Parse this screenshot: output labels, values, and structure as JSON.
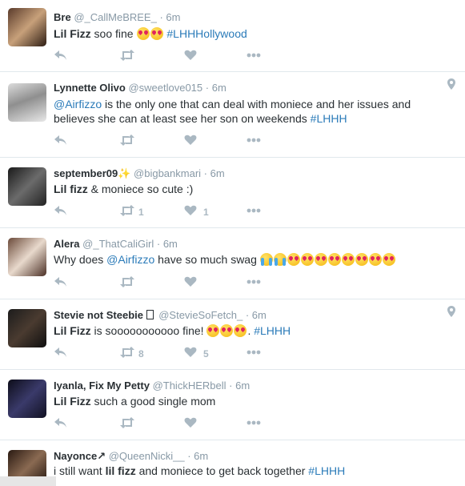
{
  "colors": {
    "link": "#2b7bb9",
    "muted": "#8899a6",
    "icon": "#aab8c2",
    "text": "#292f33",
    "border": "#e1e8ed"
  },
  "icons": {
    "reply": "reply-icon",
    "retweet": "retweet-icon",
    "like": "heart-icon",
    "more": "more-icon",
    "location": "location-pin-icon",
    "heart_eyes": "heart-eyes-emoji",
    "crying": "crying-emoji"
  },
  "tweets": [
    {
      "name": "Bre",
      "handle": "@_CallMeBREE_",
      "sep": "·",
      "time": "6m",
      "text": {
        "b1": "Lil Fizz",
        "t1": " soo fine ",
        "link1": "#LHHHollywood"
      },
      "retweets": "",
      "likes": ""
    },
    {
      "name": "Lynnette Olivo",
      "handle": "@sweetlove015",
      "sep": "·",
      "time": "6m",
      "text": {
        "link1": "@Airfizzo",
        "t1": " is the only one that can deal with moniece and her issues and believes she can at least see her son on weekends ",
        "link2": "#LHHH"
      },
      "retweets": "",
      "likes": ""
    },
    {
      "name": "september09✨",
      "handle": "@bigbankmari",
      "sep": "·",
      "time": "6m",
      "text": {
        "b1": "Lil fizz",
        "t1": " & moniece so cute :)"
      },
      "retweets": "1",
      "likes": "1"
    },
    {
      "name": "Alera",
      "handle": "@_ThatCaliGirl",
      "sep": "·",
      "time": "6m",
      "text": {
        "t1": "Why does ",
        "link1": "@Airfizzo",
        "t2": " have so much swag "
      },
      "retweets": "",
      "likes": ""
    },
    {
      "name": "Stevie not Steebie ",
      "handle": "@StevieSoFetch_",
      "sep": "·",
      "time": "6m",
      "text": {
        "b1": "Lil Fizz",
        "t1": " is sooooooooooo fine! ",
        "t2": ". ",
        "link1": "#LHHH"
      },
      "retweets": "8",
      "likes": "5"
    },
    {
      "name": "Iyanla, Fix My Petty",
      "handle": "@ThickHERbell",
      "sep": "·",
      "time": "6m",
      "text": {
        "b1": "Lil Fizz",
        "t1": " such a good single mom"
      },
      "retweets": "",
      "likes": ""
    },
    {
      "name": "Nayonce↗",
      "handle": "@QueenNicki__",
      "sep": "·",
      "time": "6m",
      "text": {
        "t1": "i still want ",
        "b1": "lil fizz",
        "t2": " and moniece to get back together ",
        "link1": "#LHHH"
      },
      "retweets": "",
      "likes": ""
    }
  ]
}
